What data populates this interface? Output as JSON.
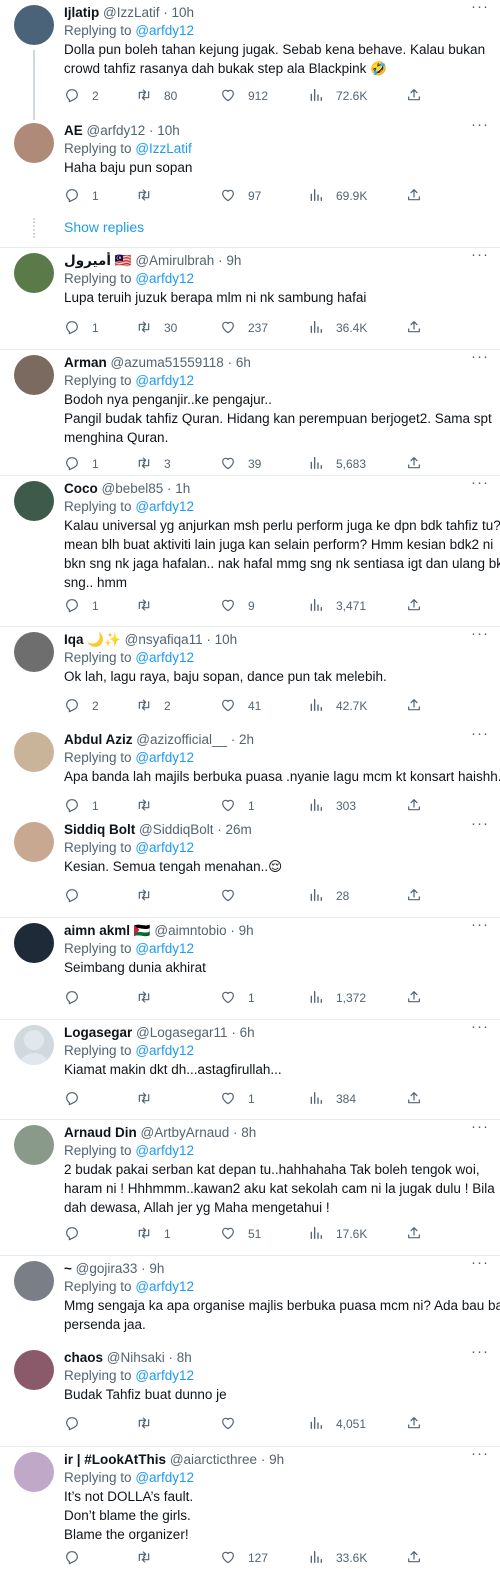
{
  "show_replies_label": "Show replies",
  "tweets": [
    {
      "name": "Ijlatip",
      "handle": "@IzzLatif",
      "time": "10h",
      "reply_prefix": "Replying to",
      "reply_to": "@arfdy12",
      "text": [
        "Dolla pun boleh tahan kejung jugak. Sebab kena behave. Kalau bukan",
        "crowd tahfiz rasanya dah bukak step ala Blackpink 🤣"
      ],
      "replies": "2",
      "retweets": "80",
      "likes": "912",
      "views": "72.6K",
      "avatar_color": "#4a6378"
    },
    {
      "name": "AE",
      "handle": "@arfdy12",
      "time": "10h",
      "reply_prefix": "Replying to",
      "reply_to": "@IzzLatif",
      "text": [
        "Haha baju pun sopan"
      ],
      "replies": "1",
      "retweets": "",
      "likes": "97",
      "views": "69.9K",
      "avatar_color": "#b08a78"
    },
    {
      "name": "أميرول 🇲🇾",
      "handle": "@Amirulbrah",
      "time": "9h",
      "reply_prefix": "Replying to",
      "reply_to": "@arfdy12",
      "text": [
        "Lupa teruih juzuk berapa mlm ni nk sambung hafai"
      ],
      "replies": "1",
      "retweets": "30",
      "likes": "237",
      "views": "36.4K",
      "avatar_color": "#5a7a4a"
    },
    {
      "name": "Arman",
      "handle": "@azuma51559118",
      "time": "6h",
      "reply_prefix": "Replying to",
      "reply_to": "@arfdy12",
      "text": [
        "Bodoh nya penganjir..ke pengajur..",
        "Pangil budak tahfiz Quran. Hidang kan perempuan berjoget2. Sama spt",
        "menghina Quran."
      ],
      "replies": "1",
      "retweets": "3",
      "likes": "39",
      "views": "5,683",
      "avatar_color": "#7a6a60"
    },
    {
      "name": "Coco",
      "handle": "@bebel85",
      "time": "1h",
      "reply_prefix": "Replying to",
      "reply_to": "@arfdy12",
      "text": [
        "Kalau universal yg anjurkan msh perlu perform juga ke dpn bdk tahfiz tu? I",
        "mean blh buat aktiviti lain juga kan selain perform? Hmm kesian bdk2 ni",
        "bkn sng nk jaga hafalan.. nak hafal mmg sng nk sentiasa igt dan ulang bkn",
        "sng.. hmm"
      ],
      "replies": "1",
      "retweets": "",
      "likes": "9",
      "views": "3,471",
      "avatar_color": "#3e5a4a"
    },
    {
      "name": "Iqa 🌙✨",
      "handle": "@nsyafiqa11",
      "time": "10h",
      "reply_prefix": "Replying to",
      "reply_to": "@arfdy12",
      "text": [
        "Ok lah, lagu raya, baju sopan, dance pun tak melebih."
      ],
      "replies": "2",
      "retweets": "2",
      "likes": "41",
      "views": "42.7K",
      "avatar_color": "#6e6e6e"
    },
    {
      "name": "Abdul Aziz",
      "handle": "@azizofficial__",
      "time": "2h",
      "reply_prefix": "Replying to",
      "reply_to": "@arfdy12",
      "text": [
        "Apa banda lah majils berbuka puasa .nyanie lagu mcm kt konsart haishh.."
      ],
      "replies": "1",
      "retweets": "",
      "likes": "1",
      "views": "303",
      "avatar_color": "#c9b49a"
    },
    {
      "name": "Siddiq Bolt",
      "handle": "@SiddiqBolt",
      "time": "26m",
      "reply_prefix": "Replying to",
      "reply_to": "@arfdy12",
      "text": [
        "Kesian. Semua tengah menahan..😌"
      ],
      "replies": "",
      "retweets": "",
      "likes": "",
      "views": "28",
      "avatar_color": "#c8a890"
    },
    {
      "name": "aimn akml 🇵🇸",
      "handle": "@aimntobio",
      "time": "9h",
      "reply_prefix": "Replying to",
      "reply_to": "@arfdy12",
      "text": [
        "Seimbang dunia akhirat"
      ],
      "replies": "",
      "retweets": "",
      "likes": "1",
      "views": "1,372",
      "avatar_color": "#1e2a38"
    },
    {
      "name": "Logasegar",
      "handle": "@Logasegar11",
      "time": "6h",
      "reply_prefix": "Replying to",
      "reply_to": "@arfdy12",
      "text": [
        "Kiamat makin dkt dh...astagfirullah..."
      ],
      "replies": "",
      "retweets": "",
      "likes": "1",
      "views": "384",
      "avatar_color": "#cfd9de"
    },
    {
      "name": "Arnaud Din",
      "handle": "@ArtbyArnaud",
      "time": "8h",
      "reply_prefix": "Replying to",
      "reply_to": "@arfdy12",
      "text": [
        "2 budak pakai serban kat depan tu..hahhahaha Tak boleh tengok woi,",
        "haram ni ! Hhhmmm..kawan2 aku kat sekolah cam ni la jugak dulu ! Bila",
        "dah dewasa, Allah jer yg Maha mengetahui !"
      ],
      "replies": "",
      "retweets": "1",
      "likes": "51",
      "views": "17.6K",
      "avatar_color": "#8a9a8a"
    },
    {
      "name": "~",
      "handle": "@gojira33",
      "time": "9h",
      "reply_prefix": "Replying to",
      "reply_to": "@arfdy12",
      "text": [
        "Mmg sengaja ka apa organise majlis berbuka puasa mcm ni? Ada bau bau",
        "persenda jaa."
      ],
      "replies": "",
      "retweets": "",
      "likes": "",
      "views": "",
      "avatar_color": "#7a7e86"
    },
    {
      "name": "chaos",
      "handle": "@Nihsaki",
      "time": "8h",
      "reply_prefix": "Replying to",
      "reply_to": "@arfdy12",
      "text": [
        "Budak Tahfiz buat dunno je"
      ],
      "replies": "",
      "retweets": "",
      "likes": "",
      "views": "4,051",
      "avatar_color": "#8a5a6a"
    },
    {
      "name": "ir | #LookAtThis",
      "handle": "@aiarcticthree",
      "time": "9h",
      "reply_prefix": "Replying to",
      "reply_to": "@arfdy12",
      "text": [
        "It’s not DOLLA’s fault.",
        "Don’t blame the girls.",
        "Blame the organizer!"
      ],
      "replies": "",
      "retweets": "",
      "likes": "127",
      "views": "33.6K",
      "avatar_color": "#c0a8c8"
    }
  ]
}
